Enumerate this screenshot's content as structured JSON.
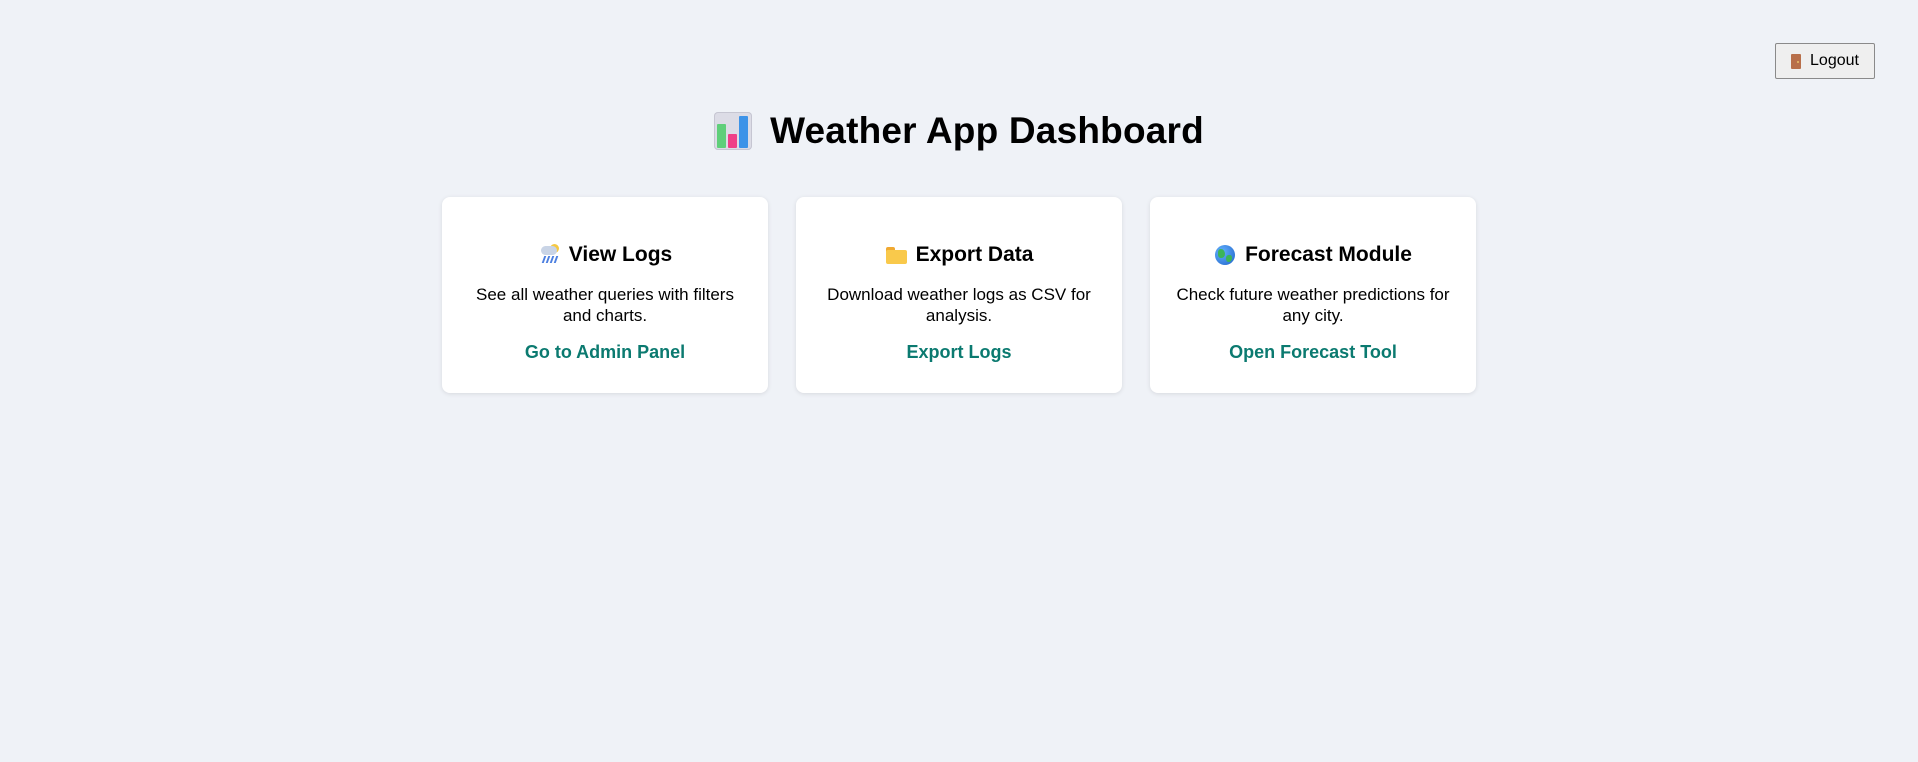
{
  "header": {
    "logout_label": "Logout",
    "logout_icon": "door-icon",
    "title": "Weather App Dashboard",
    "title_icon": "bar-chart-icon"
  },
  "cards": [
    {
      "icon": "rain-cloud-icon",
      "title": "View Logs",
      "description": "See all weather queries with filters and charts.",
      "link_label": "Go to Admin Panel"
    },
    {
      "icon": "folder-icon",
      "title": "Export Data",
      "description": "Download weather logs as CSV for analysis.",
      "link_label": "Export Logs"
    },
    {
      "icon": "globe-icon",
      "title": "Forecast Module",
      "description": "Check future weather predictions for any city.",
      "link_label": "Open Forecast Tool"
    }
  ],
  "colors": {
    "background": "#eff2f7",
    "card_background": "#ffffff",
    "link": "#0b7a70"
  }
}
